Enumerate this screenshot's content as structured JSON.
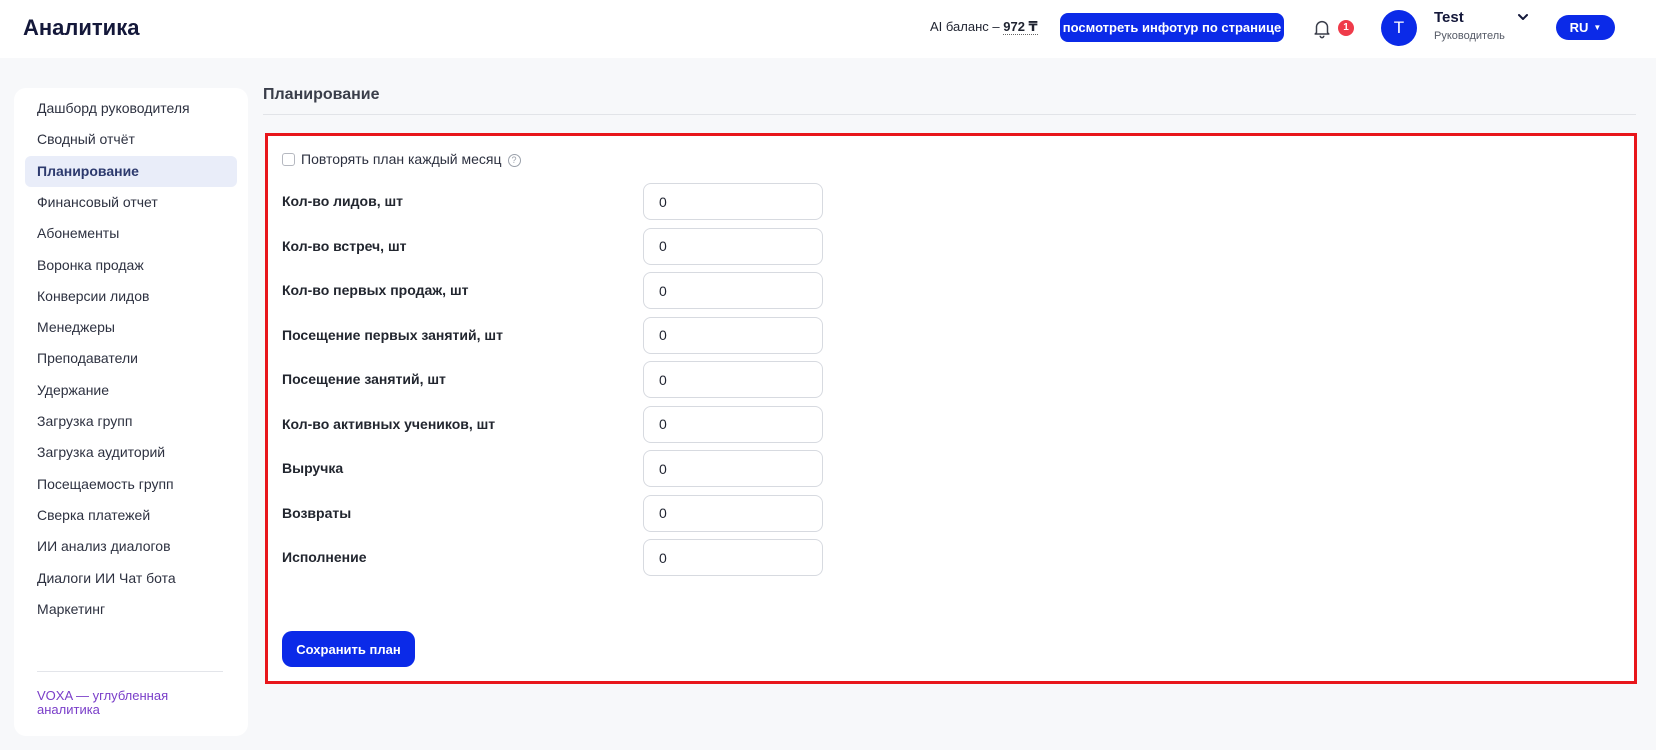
{
  "header": {
    "app_title": "Аналитика",
    "ai_balance_label": "AI баланс – ",
    "ai_balance_amount": "972 ₸",
    "tour_button": "посмотреть инфотур по странице",
    "notification_count": "1",
    "user": {
      "avatar_letter": "T",
      "name": "Test",
      "role": "Руководитель"
    },
    "language": "RU"
  },
  "sidebar": {
    "items": [
      {
        "label": "Дашборд руководителя",
        "active": false
      },
      {
        "label": "Сводный отчёт",
        "active": false
      },
      {
        "label": "Планирование",
        "active": true
      },
      {
        "label": "Финансовый отчет",
        "active": false
      },
      {
        "label": "Абонементы",
        "active": false
      },
      {
        "label": "Воронка продаж",
        "active": false
      },
      {
        "label": "Конверсии лидов",
        "active": false
      },
      {
        "label": "Менеджеры",
        "active": false
      },
      {
        "label": "Преподаватели",
        "active": false
      },
      {
        "label": "Удержание",
        "active": false
      },
      {
        "label": "Загрузка групп",
        "active": false
      },
      {
        "label": "Загрузка аудиторий",
        "active": false
      },
      {
        "label": "Посещаемость групп",
        "active": false
      },
      {
        "label": "Сверка платежей",
        "active": false
      },
      {
        "label": "ИИ анализ диалогов",
        "active": false
      },
      {
        "label": "Диалоги ИИ Чат бота",
        "active": false
      },
      {
        "label": "Маркетинг",
        "active": false
      }
    ],
    "footer_link": "VOXA — углубленная аналитика"
  },
  "main": {
    "page_title": "Планирование",
    "repeat_checkbox_label": "Повторять план каждый месяц",
    "repeat_checked": false,
    "fields": [
      {
        "label": "Кол-во лидов, шт",
        "value": "0"
      },
      {
        "label": "Кол-во встреч, шт",
        "value": "0"
      },
      {
        "label": "Кол-во первых продаж, шт",
        "value": "0"
      },
      {
        "label": "Посещение первых занятий, шт",
        "value": "0"
      },
      {
        "label": "Посещение занятий, шт",
        "value": "0"
      },
      {
        "label": "Кол-во активных учеников, шт",
        "value": "0"
      },
      {
        "label": "Выручка",
        "value": "0"
      },
      {
        "label": "Возвраты",
        "value": "0"
      },
      {
        "label": "Исполнение",
        "value": "0"
      }
    ],
    "save_button": "Сохранить план"
  },
  "colors": {
    "accent": "#0b2ae8",
    "highlight_border": "#e8161b",
    "badge": "#ef3b4a",
    "link": "#7a3ec9"
  }
}
